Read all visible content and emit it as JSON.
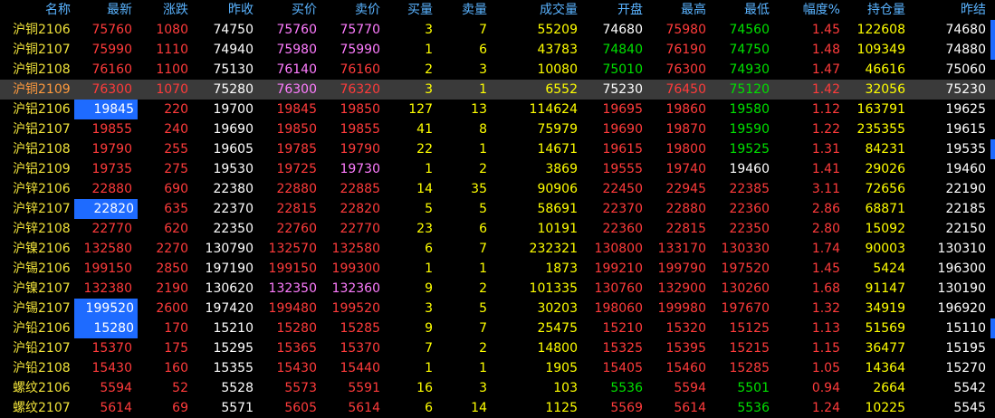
{
  "columns": [
    "名称",
    "最新",
    "涨跌",
    "昨收",
    "买价",
    "卖价",
    "买量",
    "卖量",
    "成交量",
    "开盘",
    "最高",
    "最低",
    "幅度%",
    "持仓量",
    "昨结"
  ],
  "colors": {
    "up": "#ff3b3b",
    "down": "#00e000",
    "neutral": "#ffffff",
    "name": "#f0e23a",
    "bid_up": "#ff7cff",
    "volume": "#ffff00",
    "header": "#5ab3ff",
    "highlight": "#1e6bff",
    "selected_row": "#3a3a3a"
  },
  "rows": [
    {
      "name": "沪铜2106",
      "last": "75760",
      "chg": "1080",
      "prev": "74750",
      "bid": "75760",
      "ask": "75770",
      "bidv": "3",
      "askv": "7",
      "vol": "55209",
      "open": "74680",
      "high": "75980",
      "low": "74560",
      "pct": "1.45",
      "oi": "122608",
      "settle": "74680",
      "c": {
        "last": "up",
        "chg": "up",
        "bid": "bid_up",
        "ask": "bid_up",
        "bidv": "volume",
        "askv": "volume",
        "vol": "volume",
        "open": "neutral",
        "high": "up",
        "low": "down",
        "pct": "up",
        "oi": "volume"
      },
      "mark": true
    },
    {
      "name": "沪铜2107",
      "last": "75990",
      "chg": "1110",
      "prev": "74940",
      "bid": "75980",
      "ask": "75990",
      "bidv": "1",
      "askv": "6",
      "vol": "43783",
      "open": "74840",
      "high": "76190",
      "low": "74750",
      "pct": "1.48",
      "oi": "109349",
      "settle": "74880",
      "c": {
        "last": "up",
        "chg": "up",
        "bid": "bid_up",
        "ask": "bid_up",
        "bidv": "volume",
        "askv": "volume",
        "vol": "volume",
        "open": "down",
        "high": "up",
        "low": "down",
        "pct": "up",
        "oi": "volume"
      },
      "mark": true
    },
    {
      "name": "沪铜2108",
      "last": "76160",
      "chg": "1100",
      "prev": "75130",
      "bid": "76140",
      "ask": "76160",
      "bidv": "2",
      "askv": "3",
      "vol": "10080",
      "open": "75010",
      "high": "76300",
      "low": "74930",
      "pct": "1.47",
      "oi": "46616",
      "settle": "75060",
      "c": {
        "last": "up",
        "chg": "up",
        "bid": "bid_up",
        "ask": "up",
        "bidv": "volume",
        "askv": "volume",
        "vol": "volume",
        "open": "down",
        "high": "up",
        "low": "down",
        "pct": "up",
        "oi": "volume"
      }
    },
    {
      "name": "沪铜2109",
      "last": "76300",
      "chg": "1070",
      "prev": "75280",
      "bid": "76300",
      "ask": "76320",
      "bidv": "3",
      "askv": "1",
      "vol": "6552",
      "open": "75230",
      "high": "76450",
      "low": "75120",
      "pct": "1.42",
      "oi": "32056",
      "settle": "75230",
      "c": {
        "last": "up",
        "chg": "up",
        "bid": "bid_up",
        "ask": "up",
        "bidv": "volume",
        "askv": "volume",
        "vol": "volume",
        "open": "neutral",
        "high": "up",
        "low": "down",
        "pct": "up",
        "oi": "volume"
      },
      "selected": true
    },
    {
      "name": "沪铝2106",
      "last": "19845",
      "chg": "220",
      "prev": "19700",
      "bid": "19845",
      "ask": "19850",
      "bidv": "127",
      "askv": "13",
      "vol": "114624",
      "open": "19695",
      "high": "19860",
      "low": "19580",
      "pct": "1.12",
      "oi": "163791",
      "settle": "19625",
      "c": {
        "last": "up",
        "chg": "up",
        "bid": "up",
        "ask": "up",
        "bidv": "volume",
        "askv": "volume",
        "vol": "volume",
        "open": "up",
        "high": "up",
        "low": "down",
        "pct": "up",
        "oi": "volume"
      },
      "hl": true
    },
    {
      "name": "沪铝2107",
      "last": "19855",
      "chg": "240",
      "prev": "19690",
      "bid": "19850",
      "ask": "19855",
      "bidv": "41",
      "askv": "8",
      "vol": "75979",
      "open": "19690",
      "high": "19870",
      "low": "19590",
      "pct": "1.22",
      "oi": "235355",
      "settle": "19615",
      "c": {
        "last": "up",
        "chg": "up",
        "bid": "up",
        "ask": "up",
        "bidv": "volume",
        "askv": "volume",
        "vol": "volume",
        "open": "up",
        "high": "up",
        "low": "down",
        "pct": "up",
        "oi": "volume"
      }
    },
    {
      "name": "沪铝2108",
      "last": "19790",
      "chg": "255",
      "prev": "19605",
      "bid": "19785",
      "ask": "19790",
      "bidv": "22",
      "askv": "1",
      "vol": "14671",
      "open": "19615",
      "high": "19800",
      "low": "19525",
      "pct": "1.31",
      "oi": "84231",
      "settle": "19535",
      "c": {
        "last": "up",
        "chg": "up",
        "bid": "up",
        "ask": "up",
        "bidv": "volume",
        "askv": "volume",
        "vol": "volume",
        "open": "up",
        "high": "up",
        "low": "down",
        "pct": "up",
        "oi": "volume"
      },
      "mark": true
    },
    {
      "name": "沪铝2109",
      "last": "19735",
      "chg": "275",
      "prev": "19530",
      "bid": "19725",
      "ask": "19730",
      "bidv": "1",
      "askv": "2",
      "vol": "3869",
      "open": "19555",
      "high": "19740",
      "low": "19460",
      "pct": "1.41",
      "oi": "29026",
      "settle": "19460",
      "c": {
        "last": "up",
        "chg": "up",
        "bid": "up",
        "ask": "bid_up",
        "bidv": "volume",
        "askv": "volume",
        "vol": "volume",
        "open": "up",
        "high": "up",
        "low": "neutral",
        "pct": "up",
        "oi": "volume"
      }
    },
    {
      "name": "沪锌2106",
      "last": "22880",
      "chg": "690",
      "prev": "22380",
      "bid": "22880",
      "ask": "22885",
      "bidv": "14",
      "askv": "35",
      "vol": "90906",
      "open": "22450",
      "high": "22945",
      "low": "22385",
      "pct": "3.11",
      "oi": "72656",
      "settle": "22190",
      "c": {
        "last": "up",
        "chg": "up",
        "bid": "up",
        "ask": "up",
        "bidv": "volume",
        "askv": "volume",
        "vol": "volume",
        "open": "up",
        "high": "up",
        "low": "up",
        "pct": "up",
        "oi": "volume"
      }
    },
    {
      "name": "沪锌2107",
      "last": "22820",
      "chg": "635",
      "prev": "22370",
      "bid": "22815",
      "ask": "22820",
      "bidv": "5",
      "askv": "5",
      "vol": "58691",
      "open": "22370",
      "high": "22880",
      "low": "22360",
      "pct": "2.86",
      "oi": "68871",
      "settle": "22185",
      "c": {
        "last": "up",
        "chg": "up",
        "bid": "up",
        "ask": "up",
        "bidv": "volume",
        "askv": "volume",
        "vol": "volume",
        "open": "up",
        "high": "up",
        "low": "up",
        "pct": "up",
        "oi": "volume"
      },
      "hl": true
    },
    {
      "name": "沪锌2108",
      "last": "22770",
      "chg": "620",
      "prev": "22350",
      "bid": "22760",
      "ask": "22770",
      "bidv": "23",
      "askv": "6",
      "vol": "10191",
      "open": "22360",
      "high": "22815",
      "low": "22350",
      "pct": "2.80",
      "oi": "15092",
      "settle": "22150",
      "c": {
        "last": "up",
        "chg": "up",
        "bid": "up",
        "ask": "up",
        "bidv": "volume",
        "askv": "volume",
        "vol": "volume",
        "open": "up",
        "high": "up",
        "low": "up",
        "pct": "up",
        "oi": "volume"
      }
    },
    {
      "name": "沪镍2106",
      "last": "132580",
      "chg": "2270",
      "prev": "130790",
      "bid": "132570",
      "ask": "132580",
      "bidv": "6",
      "askv": "7",
      "vol": "232321",
      "open": "130800",
      "high": "133170",
      "low": "130330",
      "pct": "1.74",
      "oi": "90003",
      "settle": "130310",
      "c": {
        "last": "up",
        "chg": "up",
        "bid": "up",
        "ask": "up",
        "bidv": "volume",
        "askv": "volume",
        "vol": "volume",
        "open": "up",
        "high": "up",
        "low": "up",
        "pct": "up",
        "oi": "volume"
      }
    },
    {
      "name": "沪锡2106",
      "last": "199150",
      "chg": "2850",
      "prev": "197190",
      "bid": "199150",
      "ask": "199300",
      "bidv": "1",
      "askv": "1",
      "vol": "1873",
      "open": "199210",
      "high": "199790",
      "low": "197520",
      "pct": "1.45",
      "oi": "5424",
      "settle": "196300",
      "c": {
        "last": "up",
        "chg": "up",
        "bid": "up",
        "ask": "up",
        "bidv": "volume",
        "askv": "volume",
        "vol": "volume",
        "open": "up",
        "high": "up",
        "low": "up",
        "pct": "up",
        "oi": "volume"
      }
    },
    {
      "name": "沪镍2107",
      "last": "132380",
      "chg": "2190",
      "prev": "130620",
      "bid": "132350",
      "ask": "132360",
      "bidv": "9",
      "askv": "2",
      "vol": "101335",
      "open": "130760",
      "high": "132900",
      "low": "130260",
      "pct": "1.68",
      "oi": "91147",
      "settle": "130190",
      "c": {
        "last": "up",
        "chg": "up",
        "bid": "bid_up",
        "ask": "bid_up",
        "bidv": "volume",
        "askv": "volume",
        "vol": "volume",
        "open": "up",
        "high": "up",
        "low": "up",
        "pct": "up",
        "oi": "volume"
      }
    },
    {
      "name": "沪锡2107",
      "last": "199520",
      "chg": "2600",
      "prev": "197420",
      "bid": "199480",
      "ask": "199520",
      "bidv": "3",
      "askv": "5",
      "vol": "30203",
      "open": "198060",
      "high": "199980",
      "low": "197670",
      "pct": "1.32",
      "oi": "34919",
      "settle": "196920",
      "c": {
        "last": "up",
        "chg": "up",
        "bid": "up",
        "ask": "up",
        "bidv": "volume",
        "askv": "volume",
        "vol": "volume",
        "open": "up",
        "high": "up",
        "low": "up",
        "pct": "up",
        "oi": "volume"
      },
      "hl": true
    },
    {
      "name": "沪铅2106",
      "last": "15280",
      "chg": "170",
      "prev": "15210",
      "bid": "15280",
      "ask": "15285",
      "bidv": "9",
      "askv": "7",
      "vol": "25475",
      "open": "15210",
      "high": "15320",
      "low": "15125",
      "pct": "1.13",
      "oi": "51569",
      "settle": "15110",
      "c": {
        "last": "up",
        "chg": "up",
        "bid": "up",
        "ask": "up",
        "bidv": "volume",
        "askv": "volume",
        "vol": "volume",
        "open": "up",
        "high": "up",
        "low": "up",
        "pct": "up",
        "oi": "volume"
      },
      "hl": true,
      "mark": true
    },
    {
      "name": "沪铅2107",
      "last": "15370",
      "chg": "175",
      "prev": "15295",
      "bid": "15365",
      "ask": "15370",
      "bidv": "7",
      "askv": "2",
      "vol": "14800",
      "open": "15325",
      "high": "15395",
      "low": "15215",
      "pct": "1.15",
      "oi": "36477",
      "settle": "15195",
      "c": {
        "last": "up",
        "chg": "up",
        "bid": "up",
        "ask": "up",
        "bidv": "volume",
        "askv": "volume",
        "vol": "volume",
        "open": "up",
        "high": "up",
        "low": "up",
        "pct": "up",
        "oi": "volume"
      }
    },
    {
      "name": "沪铅2108",
      "last": "15430",
      "chg": "160",
      "prev": "15355",
      "bid": "15430",
      "ask": "15440",
      "bidv": "1",
      "askv": "1",
      "vol": "1905",
      "open": "15405",
      "high": "15460",
      "low": "15285",
      "pct": "1.05",
      "oi": "14364",
      "settle": "15270",
      "c": {
        "last": "up",
        "chg": "up",
        "bid": "up",
        "ask": "up",
        "bidv": "volume",
        "askv": "volume",
        "vol": "volume",
        "open": "up",
        "high": "up",
        "low": "up",
        "pct": "up",
        "oi": "volume"
      }
    },
    {
      "name": "螺纹2106",
      "last": "5594",
      "chg": "52",
      "prev": "5528",
      "bid": "5573",
      "ask": "5591",
      "bidv": "16",
      "askv": "3",
      "vol": "103",
      "open": "5536",
      "high": "5594",
      "low": "5501",
      "pct": "0.94",
      "oi": "2664",
      "settle": "5542",
      "c": {
        "last": "up",
        "chg": "up",
        "bid": "up",
        "ask": "up",
        "bidv": "volume",
        "askv": "volume",
        "vol": "volume",
        "open": "down",
        "high": "up",
        "low": "down",
        "pct": "up",
        "oi": "volume"
      }
    },
    {
      "name": "螺纹2107",
      "last": "5614",
      "chg": "69",
      "prev": "5571",
      "bid": "5605",
      "ask": "5614",
      "bidv": "6",
      "askv": "14",
      "vol": "1125",
      "open": "5569",
      "high": "5614",
      "low": "5536",
      "pct": "1.24",
      "oi": "10225",
      "settle": "5545",
      "c": {
        "last": "up",
        "chg": "up",
        "bid": "up",
        "ask": "up",
        "bidv": "volume",
        "askv": "volume",
        "vol": "volume",
        "open": "up",
        "high": "up",
        "low": "down",
        "pct": "up",
        "oi": "volume"
      }
    }
  ]
}
